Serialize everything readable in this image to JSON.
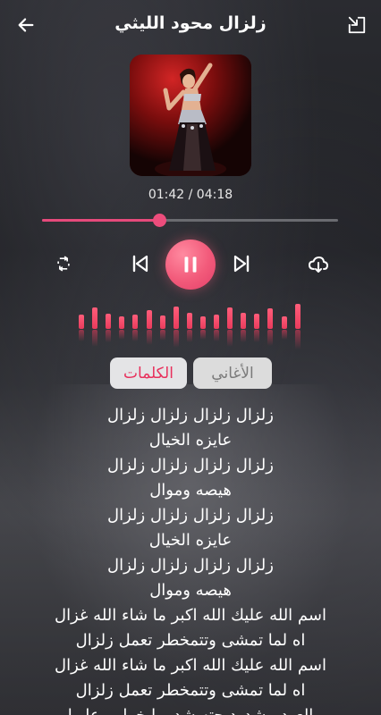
{
  "header": {
    "title": "زلزال محود الليثي"
  },
  "player": {
    "time_display": "01:42 / 04:18",
    "progress": 0.395
  },
  "tabs": {
    "songs_label": "الأغاني",
    "lyrics_label": "الكلمات",
    "active": "lyrics"
  },
  "equalizer": {
    "levels": [
      0.45,
      0.8,
      0.5,
      0.35,
      0.45,
      0.7,
      0.4,
      0.85,
      0.55,
      0.35,
      0.45,
      0.8,
      0.55,
      0.5,
      0.75,
      0.35,
      1.0
    ]
  },
  "lyrics": [
    "زلزال زلزال زلزال زلزال",
    "عايزه الخيال",
    "زلزال زلزال زلزال زلزال",
    "هيصه وموال",
    "زلزال زلزال زلزال زلزال",
    "عايزه الخيال",
    "زلزال زلزال زلزال زلزال",
    "هيصه وموال",
    "اسم الله عليك الله اكبر ما شاء الله غزال",
    "اه لما تمشى وتتمخطر تعمل زلزال",
    "اسم الله عليك الله اكبر ما شاء الله غزال",
    "اه لما تمشى وتتمخطر تعمل زلزال",
    "العود مشدود حته شدو يا خرابي عليها"
  ],
  "colors": {
    "accent": "#e8305c",
    "progress_fill": "#e64a7b",
    "eq_bar": "#e93b5c"
  }
}
